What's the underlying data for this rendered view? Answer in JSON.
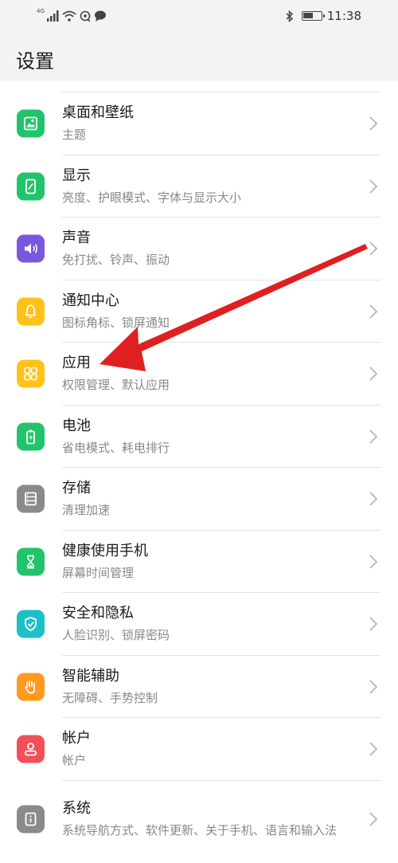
{
  "status": {
    "network": "4G",
    "time": "11:38",
    "battery_level": 0.55
  },
  "header": {
    "title": "设置"
  },
  "items": [
    {
      "title": "桌面和壁纸",
      "sub": "主题",
      "color": "#22c46b",
      "icon": "wallpaper-icon"
    },
    {
      "title": "显示",
      "sub": "亮度、护眼模式、字体与显示大小",
      "color": "#22c46b",
      "icon": "display-icon"
    },
    {
      "title": "声音",
      "sub": "免打扰、铃声、振动",
      "color": "#7b57e0",
      "icon": "sound-icon"
    },
    {
      "title": "通知中心",
      "sub": "图标角标、锁屏通知",
      "color": "#ffc21a",
      "icon": "bell-icon"
    },
    {
      "title": "应用",
      "sub": "权限管理、默认应用",
      "color": "#ffc21a",
      "icon": "apps-icon"
    },
    {
      "title": "电池",
      "sub": "省电模式、耗电排行",
      "color": "#22c46b",
      "icon": "battery-icon"
    },
    {
      "title": "存储",
      "sub": "清理加速",
      "color": "#8a8a8a",
      "icon": "storage-icon"
    },
    {
      "title": "健康使用手机",
      "sub": "屏幕时间管理",
      "color": "#22c46b",
      "icon": "hourglass-icon"
    },
    {
      "title": "安全和隐私",
      "sub": "人脸识别、锁屏密码",
      "color": "#1cc0c8",
      "icon": "shield-icon"
    },
    {
      "title": "智能辅助",
      "sub": "无障碍、手势控制",
      "color": "#ff9a1f",
      "icon": "hand-icon"
    },
    {
      "title": "帐户",
      "sub": "帐户",
      "color": "#f0505a",
      "icon": "user-icon"
    },
    {
      "title": "系统",
      "sub": "系统导航方式、软件更新、关于手机、语言和输入法",
      "color": "#8a8a8a",
      "icon": "info-icon"
    }
  ],
  "annotation": {
    "color": "#e02020",
    "points_to": "应用"
  }
}
